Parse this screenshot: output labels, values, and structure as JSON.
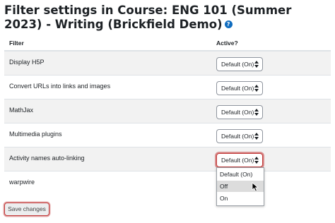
{
  "page": {
    "title": "Filter settings in Course: ENG 101 (Summer 2023) - Writing (Brickfield Demo)",
    "help_icon": "question-circle-icon"
  },
  "table": {
    "headers": {
      "filter": "Filter",
      "active": "Active?"
    },
    "rows": [
      {
        "name": "Display H5P",
        "value": "Default (On)"
      },
      {
        "name": "Convert URLs into links and images",
        "value": "Default (On)"
      },
      {
        "name": "MathJax",
        "value": "Default (On)"
      },
      {
        "name": "Multimedia plugins",
        "value": "Default (On)"
      },
      {
        "name": "Activity names auto-linking",
        "value": "Default (On)"
      },
      {
        "name": "warpwire",
        "value": "Default (On)"
      }
    ]
  },
  "dropdown": {
    "options": [
      "Default (On)",
      "Off",
      "On"
    ],
    "hovered": "Off"
  },
  "actions": {
    "save_label": "Save changes"
  },
  "colors": {
    "focus_ring": "#c23a3a",
    "help_icon": "#0f6cbf",
    "row_stripe": "#f2f2f2"
  }
}
